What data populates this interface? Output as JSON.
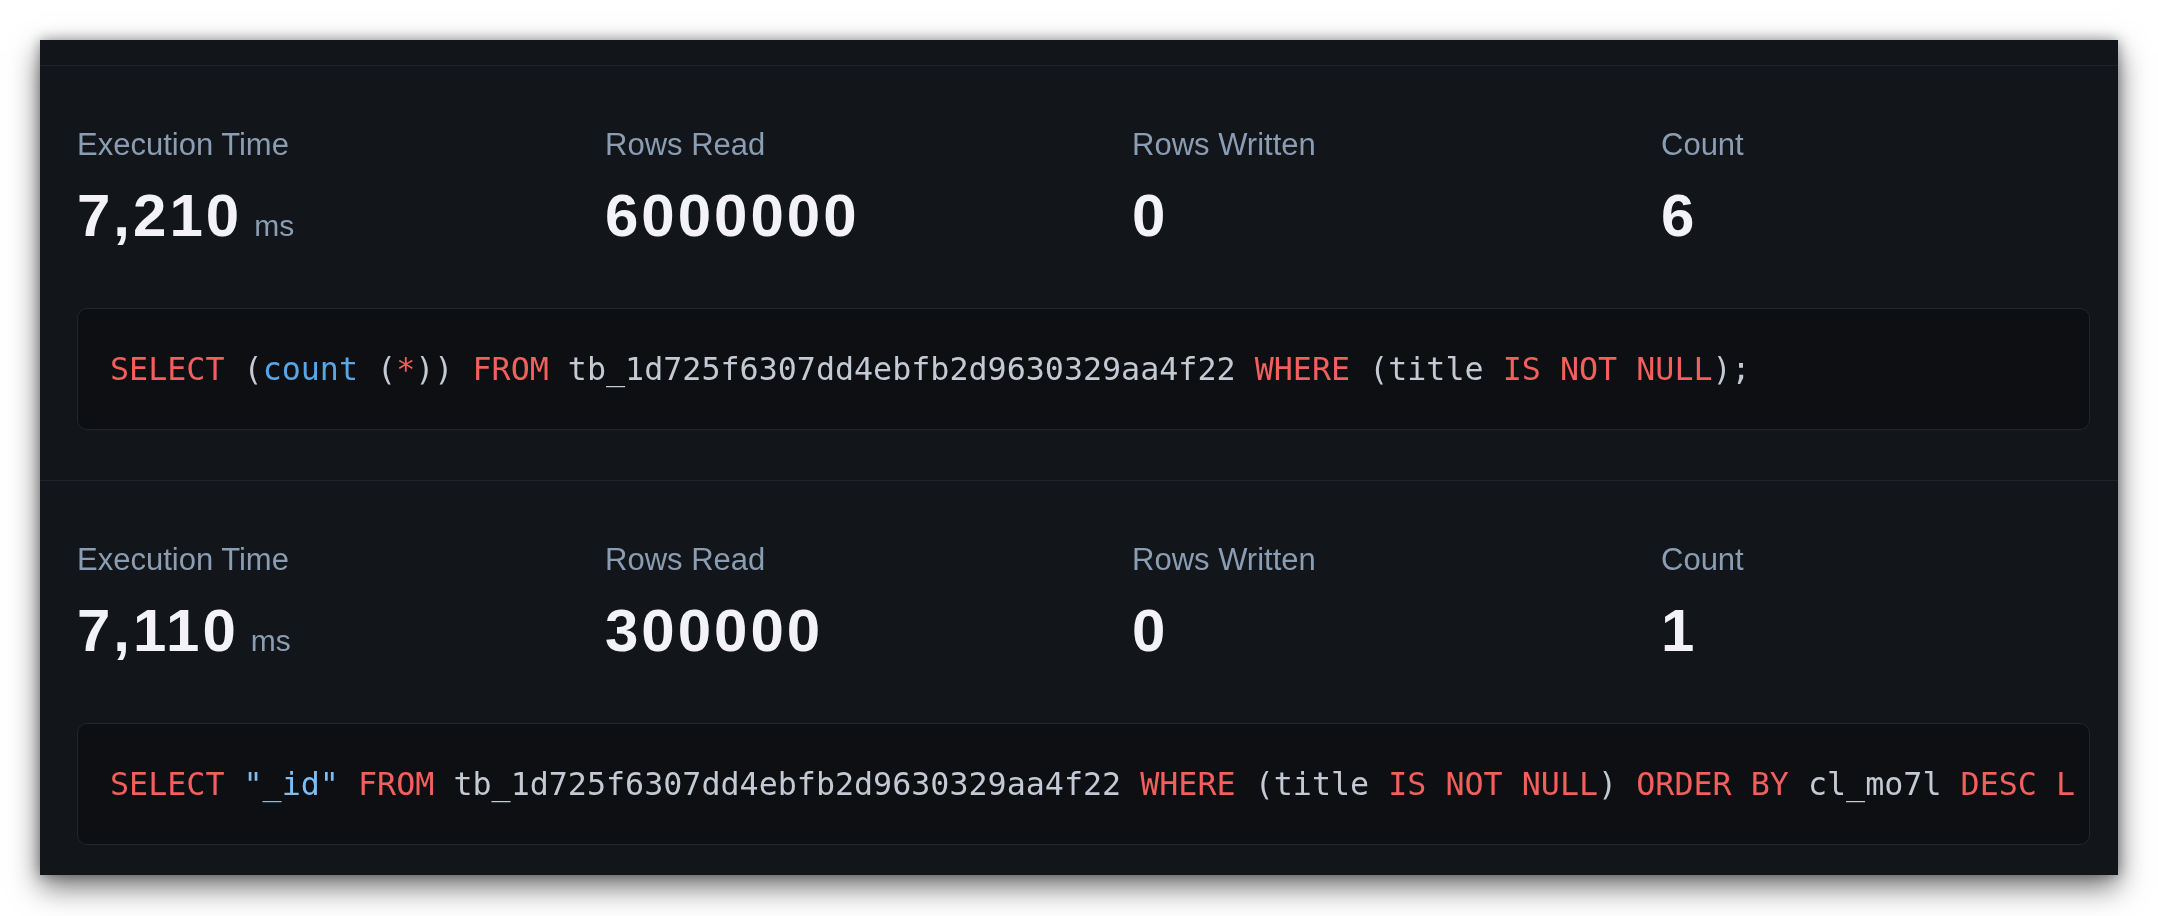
{
  "queries": [
    {
      "metrics": [
        {
          "label": "Execution Time",
          "value": "7,210",
          "unit": "ms"
        },
        {
          "label": "Rows Read",
          "value": "6000000"
        },
        {
          "label": "Rows Written",
          "value": "0"
        },
        {
          "label": "Count",
          "value": "6"
        }
      ],
      "sql": [
        {
          "kind": "keyword",
          "text": "SELECT"
        },
        {
          "kind": "plain",
          "text": " ("
        },
        {
          "kind": "function",
          "text": "count"
        },
        {
          "kind": "plain",
          "text": " ("
        },
        {
          "kind": "operator",
          "text": "*"
        },
        {
          "kind": "plain",
          "text": ")) "
        },
        {
          "kind": "keyword",
          "text": "FROM"
        },
        {
          "kind": "plain",
          "text": " tb_1d725f6307dd4ebfb2d9630329aa4f22 "
        },
        {
          "kind": "keyword",
          "text": "WHERE"
        },
        {
          "kind": "plain",
          "text": " (title "
        },
        {
          "kind": "keyword",
          "text": "IS NOT NULL"
        },
        {
          "kind": "plain",
          "text": ");"
        }
      ]
    },
    {
      "metrics": [
        {
          "label": "Execution Time",
          "value": "7,110",
          "unit": "ms"
        },
        {
          "label": "Rows Read",
          "value": "300000"
        },
        {
          "label": "Rows Written",
          "value": "0"
        },
        {
          "label": "Count",
          "value": "1"
        }
      ],
      "sql": [
        {
          "kind": "keyword",
          "text": "SELECT "
        },
        {
          "kind": "string",
          "text": "\"_id\""
        },
        {
          "kind": "keyword",
          "text": " FROM"
        },
        {
          "kind": "plain",
          "text": " tb_1d725f6307dd4ebfb2d9630329aa4f22 "
        },
        {
          "kind": "keyword",
          "text": "WHERE"
        },
        {
          "kind": "plain",
          "text": " (title "
        },
        {
          "kind": "keyword",
          "text": "IS NOT NULL"
        },
        {
          "kind": "plain",
          "text": ") "
        },
        {
          "kind": "keyword",
          "text": "ORDER BY"
        },
        {
          "kind": "plain",
          "text": " cl_mo7l "
        },
        {
          "kind": "keyword",
          "text": "DESC L"
        }
      ]
    }
  ]
}
